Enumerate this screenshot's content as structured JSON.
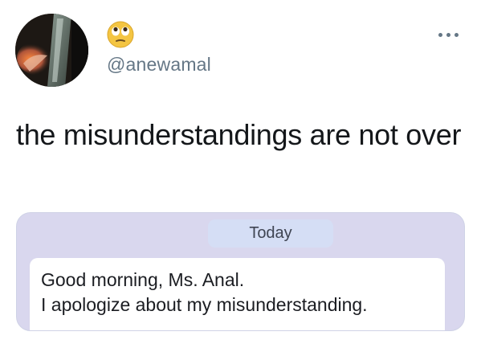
{
  "tweet": {
    "author": {
      "handle": "@anewamal",
      "avatar_icon": "profile-photo",
      "badge_icon": "face-with-rolling-eyes-emoji"
    },
    "more_icon": "ellipsis-icon",
    "text": "the misunderstandings are not over",
    "media": {
      "date_label": "Today",
      "message_lines": [
        "Good morning, Ms. Anal.",
        "I apologize about my misunderstanding."
      ]
    }
  },
  "colors": {
    "text_primary": "#14171a",
    "text_secondary": "#657786",
    "media_background": "#d9d7ee",
    "date_pill_background": "#d5def5",
    "bubble_background": "#ffffff"
  }
}
